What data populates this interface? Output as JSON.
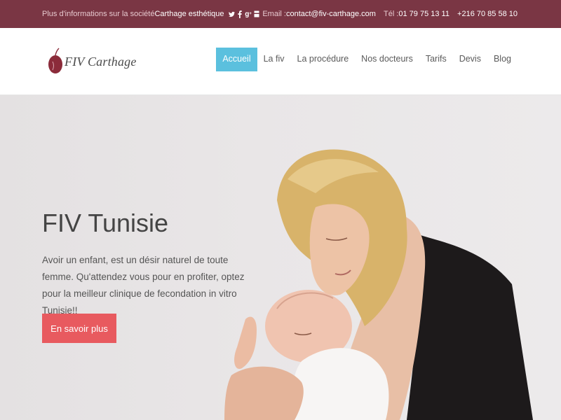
{
  "topbar": {
    "info_text": "Plus d'informations sur la société ",
    "company_link": "Carthage esthétique",
    "social_icons": [
      "twitter-icon",
      "facebook-icon",
      "google-plus-icon",
      "youtube-icon"
    ],
    "email_label": "Email : ",
    "email_value": "contact@fiv-carthage.com",
    "tel_label": "Tél : ",
    "tel_value_1": "01 79 75 13 11",
    "tel_value_2": "+216 70 85 58 10"
  },
  "logo": {
    "text": "FIV Carthage"
  },
  "nav": {
    "items": [
      {
        "label": "Accueil",
        "active": true
      },
      {
        "label": "La fiv"
      },
      {
        "label": "La procédure"
      },
      {
        "label": "Nos docteurs"
      },
      {
        "label": "Tarifs"
      },
      {
        "label": "Devis"
      },
      {
        "label": "Blog"
      }
    ]
  },
  "hero": {
    "title": "FIV Tunisie",
    "text": "Avoir un enfant, est un désir naturel de toute femme. Qu'attendez vous pour en profiter, optez pour la meilleur clinique de fecondation in vitro Tunisie!!",
    "button": "En savoir plus"
  },
  "colors": {
    "topbar_bg": "#7a3644",
    "nav_active_bg": "#5bc0de",
    "cta_bg": "#e85a5f",
    "logo_red": "#8b2b3a"
  }
}
